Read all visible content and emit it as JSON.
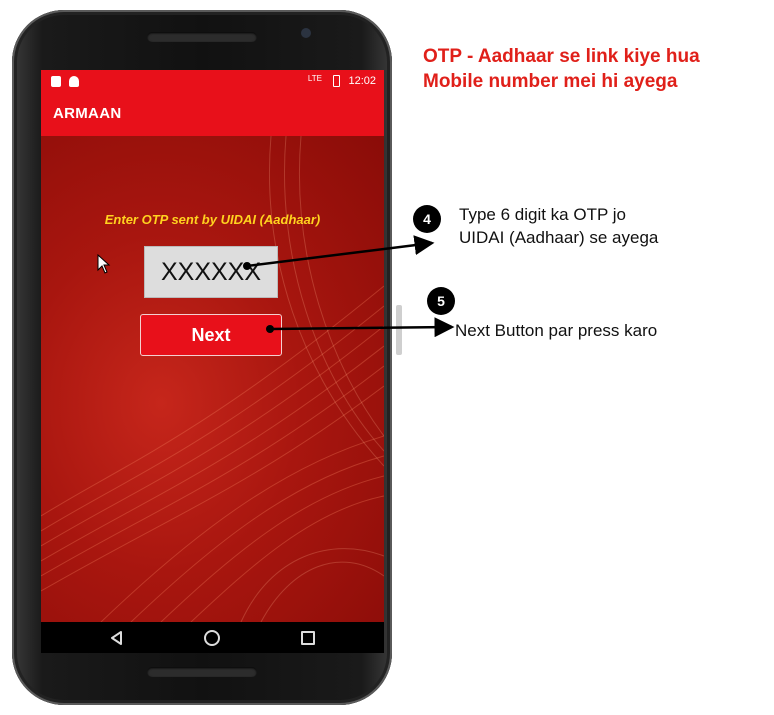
{
  "app": {
    "title": "ARMAAN",
    "status_time": "12:02",
    "status_signal": "LTE"
  },
  "form": {
    "prompt": "Enter OTP sent by UIDAI (Aadhaar)",
    "otp_value": "XXXXXX",
    "next_label": "Next"
  },
  "annotations": {
    "headline_line1": "OTP - Aadhaar se link kiye hua",
    "headline_line2": "Mobile number mei hi ayega",
    "step4_number": "4",
    "step4_line1": "Type 6 digit  ka  OTP jo",
    "step4_line2": "UIDAI (Aadhaar) se ayega",
    "step5_number": "5",
    "step5_text": "Next Button par press karo"
  },
  "colors": {
    "accent": "#e8101a",
    "headline": "#e0201a",
    "prompt": "#ffd21f"
  },
  "icons": [
    "notification-icon",
    "android-icon",
    "battery-icon",
    "back-icon",
    "home-icon",
    "recent-apps-icon",
    "mouse-cursor-icon"
  ]
}
